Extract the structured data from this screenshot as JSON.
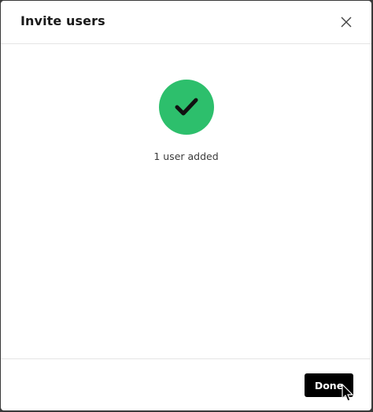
{
  "dialog": {
    "title": "Invite users",
    "close_icon": "close-icon",
    "status_icon": "checkmark-icon",
    "status_text": "1 user added",
    "done_label": "Done"
  },
  "colors": {
    "success": "#2dbf6c",
    "button_bg": "#000000",
    "button_text": "#ffffff"
  }
}
